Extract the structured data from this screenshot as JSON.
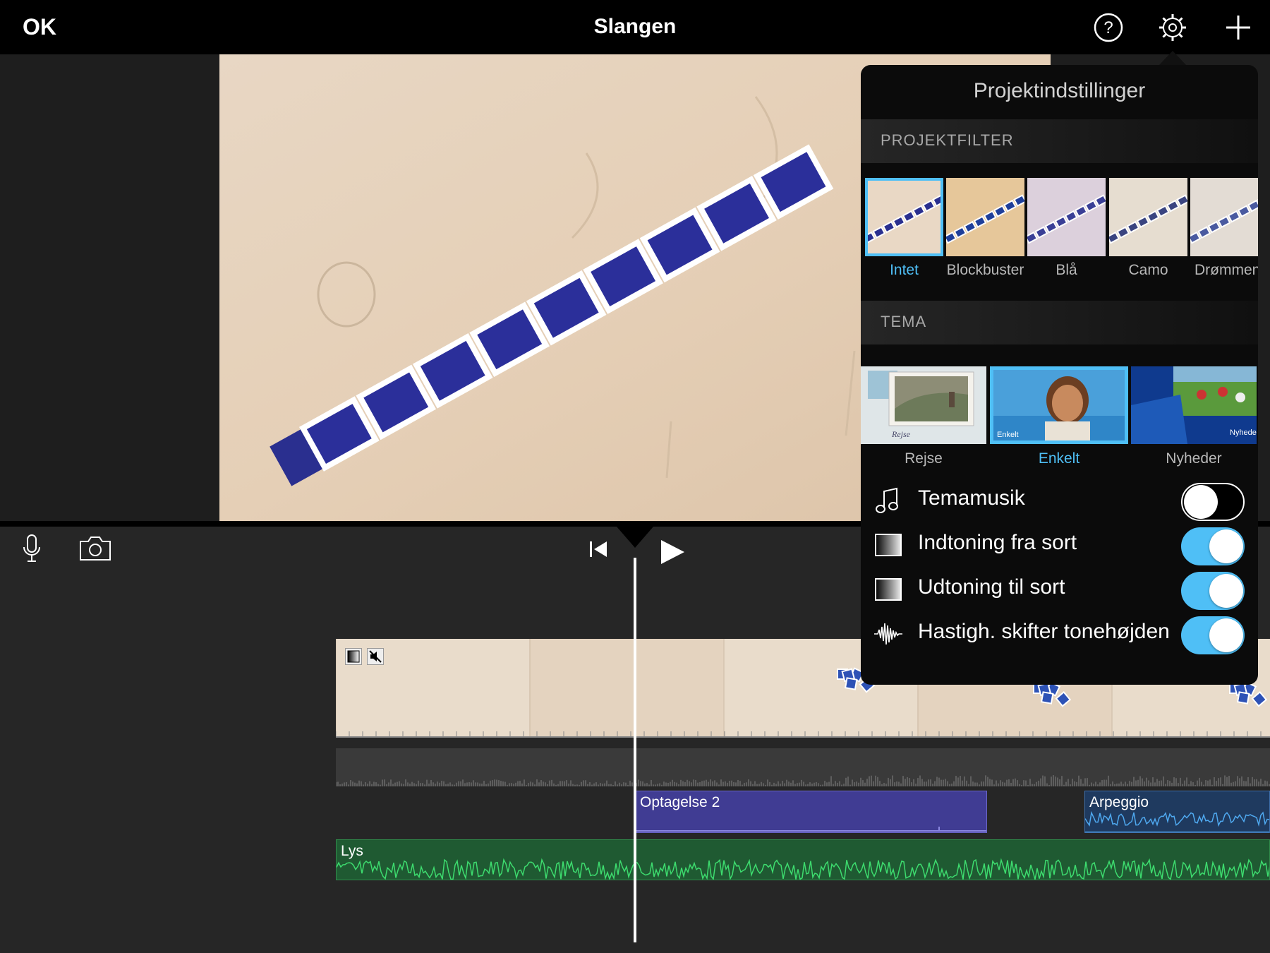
{
  "topbar": {
    "ok_label": "OK",
    "title": "Slangen",
    "icons": [
      "help-icon",
      "gear-icon",
      "plus-icon"
    ]
  },
  "controls": {
    "icons": [
      "microphone-icon",
      "camera-icon",
      "skip-to-start-icon",
      "play-icon"
    ]
  },
  "timeline": {
    "video_badges": [
      "fade-icon",
      "muted-speaker-icon"
    ],
    "clips": {
      "recording": "Optagelse 2",
      "music": "Arpeggio",
      "background": "Lys"
    }
  },
  "settings": {
    "title": "Projektindstillinger",
    "filter_section": "PROJEKTFILTER",
    "filters": [
      {
        "label": "Intet",
        "selected": true
      },
      {
        "label": "Blockbuster",
        "selected": false
      },
      {
        "label": "Blå",
        "selected": false
      },
      {
        "label": "Camo",
        "selected": false
      },
      {
        "label": "Drømmende",
        "selected": false
      }
    ],
    "theme_section": "TEMA",
    "themes": [
      {
        "label": "Rejse",
        "selected": false,
        "caption": "Rejse"
      },
      {
        "label": "Enkelt",
        "selected": true,
        "caption": "Enkelt"
      },
      {
        "label": "Nyheder",
        "selected": false,
        "caption": "Nyheder"
      }
    ],
    "toggles": [
      {
        "label": "Temamusik",
        "icon": "music-note-icon",
        "on": false
      },
      {
        "label": "Indtoning fra sort",
        "icon": "fade-in-icon",
        "on": true
      },
      {
        "label": "Udtoning til sort",
        "icon": "fade-out-icon",
        "on": true
      },
      {
        "label": "Hastigh. skifter tonehøjden",
        "icon": "waveform-icon",
        "on": true
      }
    ]
  },
  "colors": {
    "accent": "#4fbff6",
    "recording_clip": "#403c93",
    "music_clip": "#1f3a5f",
    "background_clip": "#1f5a32"
  }
}
